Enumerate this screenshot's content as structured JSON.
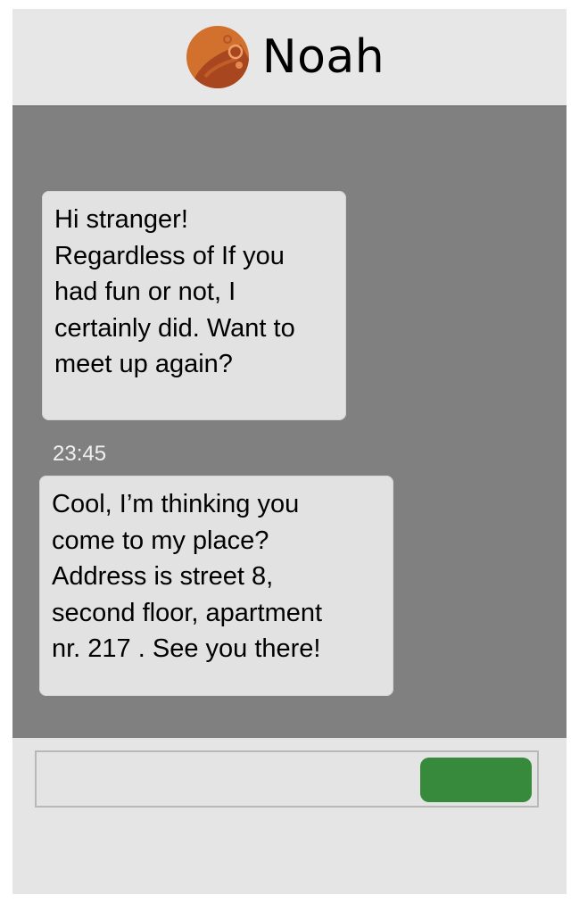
{
  "header": {
    "contact_name": "Noah",
    "avatar_icon": "planet-avatar-icon",
    "avatar_color": "#d2702e"
  },
  "messages": [
    {
      "text": "Hi stranger!\nRegardless of If you\nhad fun or not, I\ncertainly did. Want to\nmeet up again?"
    },
    {
      "timestamp": "23:45",
      "text": "Cool, I’m thinking you\ncome to my place?\nAddress is street 8,\nsecond floor, apartment\nnr. 217 . See you there!"
    }
  ],
  "composer": {
    "input_value": "",
    "send_button_color": "#378a3c"
  },
  "colors": {
    "chat_background": "#808080",
    "bubble_background": "#e2e2e2",
    "header_background": "#e7e7e7"
  }
}
